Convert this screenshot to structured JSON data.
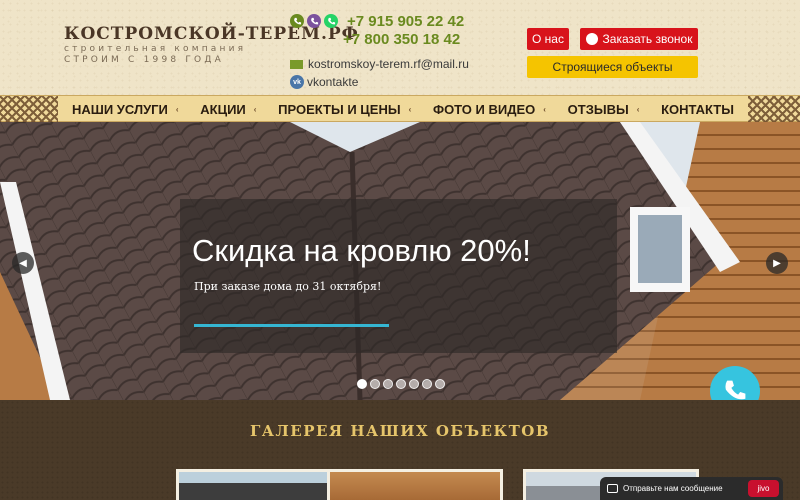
{
  "header": {
    "logo_title": "КОСТРОМСКОЙ-ТЕРЕМ.РФ",
    "logo_tagline": "строительная компания",
    "logo_since": "СТРОИМ С 1998 ГОДА",
    "phone1": "+7 915 905 22 42",
    "phone2": "+7 800 350 18 42",
    "email": "kostromskoy-terem.rf@mail.ru",
    "vk": "vkontakte",
    "btn_about": "О нас",
    "btn_call": "Заказать звонок",
    "btn_objects": "Строящиеся объекты"
  },
  "nav": {
    "items": [
      "НАШИ УСЛУГИ",
      "АКЦИИ",
      "ПРОЕКТЫ И ЦЕНЫ",
      "ФОТО И ВИДЕО",
      "ОТЗЫВЫ",
      "КОНТАКТЫ"
    ]
  },
  "hero": {
    "title": "Скидка на кровлю 20%!",
    "subtitle": "При заказе дома до 31 октября!",
    "slides_count": 7,
    "active_slide": 1
  },
  "gallery": {
    "title": "ГАЛЕРЕЯ НАШИХ ОБЪЕКТОВ"
  },
  "chat": {
    "label": "Отправьте нам сообщение",
    "brand": "jivo"
  },
  "colors": {
    "accent_red": "#d8131b",
    "accent_yellow": "#f5c400",
    "phone_green": "#6a8a1f",
    "hero_line": "#35b6d2",
    "call_bubble": "#36c4df"
  }
}
